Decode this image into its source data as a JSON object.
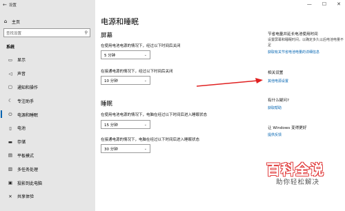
{
  "window": {
    "title": "设置",
    "controls": [
      "—",
      "☐",
      "✕"
    ]
  },
  "sidebar": {
    "home_label": "主页",
    "search_placeholder": "查找设置",
    "section_label": "系统",
    "items": [
      {
        "label": "显示",
        "icon": "monitor-icon"
      },
      {
        "label": "声音",
        "icon": "speaker-icon"
      },
      {
        "label": "通知和操作",
        "icon": "notification-icon"
      },
      {
        "label": "专注助手",
        "icon": "moon-icon"
      },
      {
        "label": "电源和睡眠",
        "icon": "power-icon",
        "active": true
      },
      {
        "label": "电池",
        "icon": "battery-icon"
      },
      {
        "label": "存储",
        "icon": "storage-icon"
      },
      {
        "label": "平板模式",
        "icon": "tablet-icon"
      },
      {
        "label": "多任务处理",
        "icon": "multitask-icon"
      },
      {
        "label": "投影到此电脑",
        "icon": "project-icon"
      },
      {
        "label": "共享体验",
        "icon": "share-icon"
      }
    ]
  },
  "main": {
    "title": "电源和睡眠",
    "screen": {
      "heading": "屏幕",
      "battery_label": "在使用电池电源的情况下，经过以下时间后关闭",
      "battery_value": "5 分钟",
      "plugged_label": "在接通电源的情况下，经过以下时间后关闭",
      "plugged_value": "10 分钟"
    },
    "sleep": {
      "heading": "睡眠",
      "battery_label": "在使用电池电源的情况下，电脑在经过以下时间后进入睡眠状态",
      "battery_value": "15 分钟",
      "plugged_label": "在接通电源的情况下，电脑在经过以下时间后进入睡眠状态",
      "plugged_value": "30 分钟"
    }
  },
  "right": {
    "tip_heading": "节省电量并延长电池使用时间",
    "tip_text": "设置屏幕和睡眠时间，以确定多久以后电池电量不足",
    "tip_link": "获取有关节省电池电量的详细信息",
    "related_heading": "相关设置",
    "related_link": "其他电源设置",
    "help_heading": "有什么疑问?",
    "help_link": "获取帮助",
    "feedback_heading": "让 Windows 变得更好",
    "feedback_link": "提供反馈"
  },
  "watermark": {
    "title": "百科全说",
    "subtitle": "助你轻松解决"
  },
  "colors": {
    "accent": "#0063b1",
    "sidebar_bg": "#e6e6e6",
    "main_bg": "#ffffff",
    "arrow": "#e02020"
  }
}
